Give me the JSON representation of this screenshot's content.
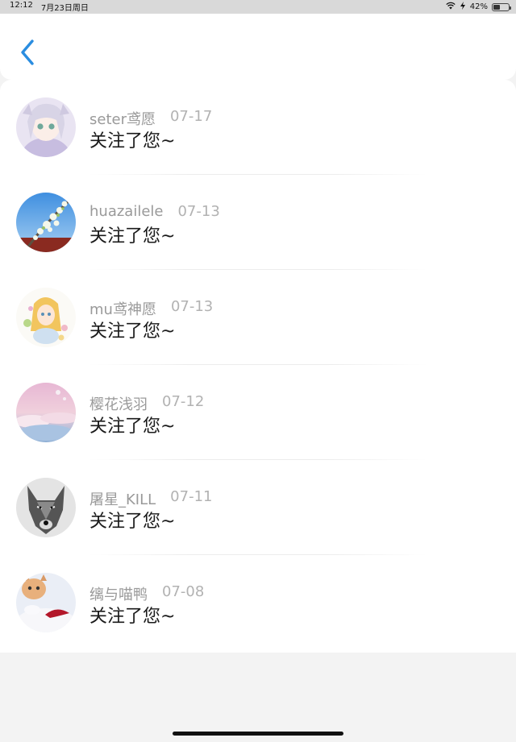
{
  "status_bar": {
    "time": "12:12",
    "date": "7月23日周日",
    "battery": "42%",
    "battery_level": 0.42
  },
  "header": {
    "back_icon": "chevron-left-icon",
    "accent": "#2a8de0"
  },
  "notifications": [
    {
      "name": "seter鸢愿",
      "date": "07-17",
      "message": "关注了您~",
      "avatar": "anime-girl-avatar"
    },
    {
      "name": "huazailele",
      "date": "07-13",
      "message": "关注了您~",
      "avatar": "blossom-sky-avatar"
    },
    {
      "name": "mu鸢神愿",
      "date": "07-13",
      "message": "关注了您~",
      "avatar": "anime-flower-avatar"
    },
    {
      "name": "樱花浅羽",
      "date": "07-12",
      "message": "关注了您~",
      "avatar": "pink-clouds-avatar"
    },
    {
      "name": "屠星_KILL",
      "date": "07-11",
      "message": "关注了您~",
      "avatar": "wolf-avatar"
    },
    {
      "name": "缡与喵鸭",
      "date": "07-08",
      "message": "关注了您~",
      "avatar": "kitten-avatar"
    }
  ]
}
